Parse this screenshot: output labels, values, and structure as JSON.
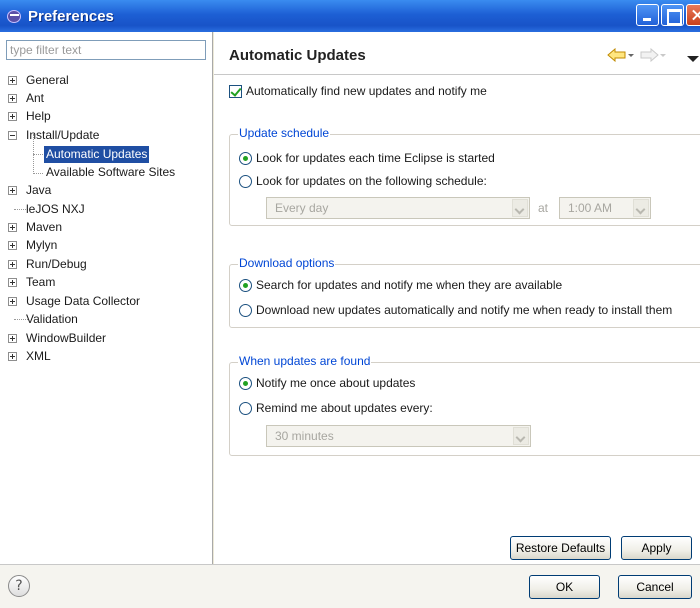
{
  "window": {
    "title": "Preferences",
    "icon": "eclipse-icon"
  },
  "filter": {
    "placeholder": "type filter text"
  },
  "tree": {
    "items": [
      {
        "label": "General",
        "expander": "plus"
      },
      {
        "label": "Ant",
        "expander": "plus"
      },
      {
        "label": "Help",
        "expander": "plus"
      },
      {
        "label": "Install/Update",
        "expander": "minus"
      },
      {
        "label": "Automatic Updates",
        "selected": true
      },
      {
        "label": "Available Software Sites"
      },
      {
        "label": "Java",
        "expander": "plus"
      },
      {
        "label": "leJOS NXJ"
      },
      {
        "label": "Maven",
        "expander": "plus"
      },
      {
        "label": "Mylyn",
        "expander": "plus"
      },
      {
        "label": "Run/Debug",
        "expander": "plus"
      },
      {
        "label": "Team",
        "expander": "plus"
      },
      {
        "label": "Usage Data Collector",
        "expander": "plus"
      },
      {
        "label": "Validation"
      },
      {
        "label": "WindowBuilder",
        "expander": "plus"
      },
      {
        "label": "XML",
        "expander": "plus"
      }
    ]
  },
  "page": {
    "title": "Automatic Updates",
    "auto_find": {
      "label": "Automatically find new updates and notify me",
      "checked": true
    },
    "schedule": {
      "legend": "Update schedule",
      "option_startup": "Look for updates each time Eclipse is started",
      "option_schedule": "Look for updates on the following schedule:",
      "frequency": "Every day",
      "at_label": "at",
      "time": "1:00 AM"
    },
    "download": {
      "legend": "Download options",
      "option_notify": "Search for updates and notify me when they are available",
      "option_auto": "Download new updates automatically and notify me when ready to install them"
    },
    "found": {
      "legend": "When updates are found",
      "option_once": "Notify me once about updates",
      "option_remind": "Remind me about updates every:",
      "interval": "30 minutes"
    },
    "restore_defaults": "Restore Defaults",
    "apply": "Apply"
  },
  "footer": {
    "ok": "OK",
    "cancel": "Cancel",
    "help_glyph": "?"
  },
  "colors": {
    "titlebar": "#1d5fd4",
    "selection": "#1f4ea3",
    "group_legend": "#0046d5",
    "radio_check": "#21a121",
    "nav_arrow": "#e8b000"
  }
}
